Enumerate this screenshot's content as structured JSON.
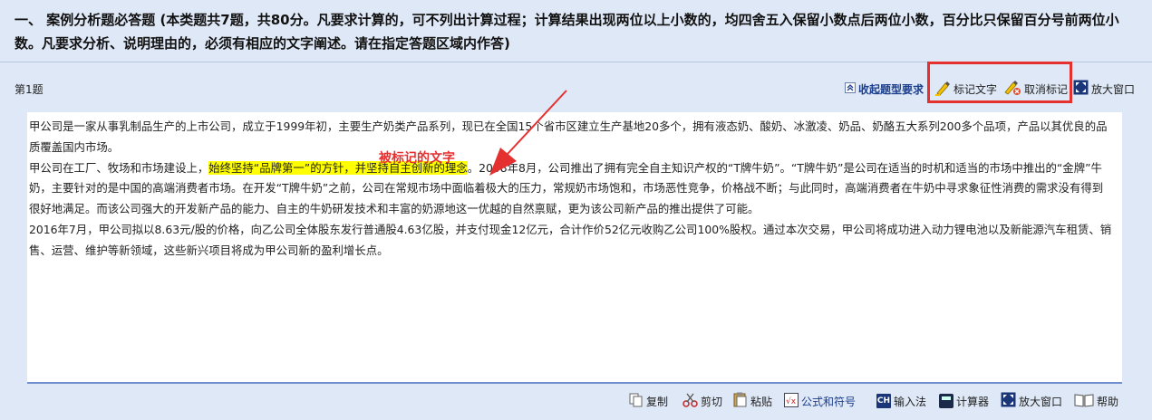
{
  "header": {
    "instruction": "一、 案例分析题必答题 (本类题共7题，共80分。凡要求计算的，可不列出计算过程；计算结果出现两位以上小数的，均四舍五入保留小数点后两位小数，百分比只保留百分号前两位小数。凡要求分析、说明理由的，必须有相应的文字阐述。请在指定答题区域内作答)"
  },
  "question": {
    "label": "第1题",
    "collapse_label": "收起题型要求",
    "mark_text_label": "标记文字",
    "unmark_label": "取消标记",
    "enlarge_label": "放大窗口"
  },
  "passage": {
    "p1": "甲公司是一家从事乳制品生产的上市公司，成立于1999年初，主要生产奶类产品系列，现已在全国15个省市区建立生产基地20多个，拥有液态奶、酸奶、冰激凌、奶品、奶酪五大系列200多个品项，产品以其优良的品质覆盖国内市场。",
    "p2_before": "甲公司在工厂、牧场和市场建设上，",
    "p2_highlight": "始终坚持“品牌第一”的方针，并坚持自主创新的理念",
    "p2_after": "。2008年8月，公司推出了拥有完全自主知识产权的“T牌牛奶”。“T牌牛奶”是公司在适当的时机和适当的市场中推出的“金牌”牛奶，主要针对的是中国的高端消费者市场。在开发“T牌牛奶”之前，公司在常规市场中面临着极大的压力，常规奶市场饱和，市场恶性竞争，价格战不断；与此同时，高端消费者在牛奶中寻求象征性消费的需求没有得到很好地满足。而该公司强大的开发新产品的能力、自主的牛奶研发技术和丰富的奶源地这一优越的自然禀赋，更为该公司新产品的推出提供了可能。",
    "p3": "2016年7月，甲公司拟以8.63元/股的价格，向乙公司全体股东发行普通股4.63亿股，并支付现金12亿元，合计作价52亿元收购乙公司100%股权。通过本次交易，甲公司将成功进入动力锂电池以及新能源汽车租赁、销售、运营、维护等新领域，这些新兴项目将成为甲公司新的盈利增长点。"
  },
  "annotation": {
    "label": "被标记的文字",
    "color": "#e53030"
  },
  "bottom_toolbar": {
    "copy": "复制",
    "cut": "剪切",
    "paste": "粘贴",
    "formula": "公式和符号",
    "ime_icon": "CH",
    "ime": "输入法",
    "calculator": "计算器",
    "enlarge": "放大窗口",
    "help": "帮助"
  },
  "colors": {
    "background": "#dfe8f6",
    "highlight": "#ffff00",
    "accent_red": "#e53030",
    "link_blue": "#1a3e8c"
  }
}
